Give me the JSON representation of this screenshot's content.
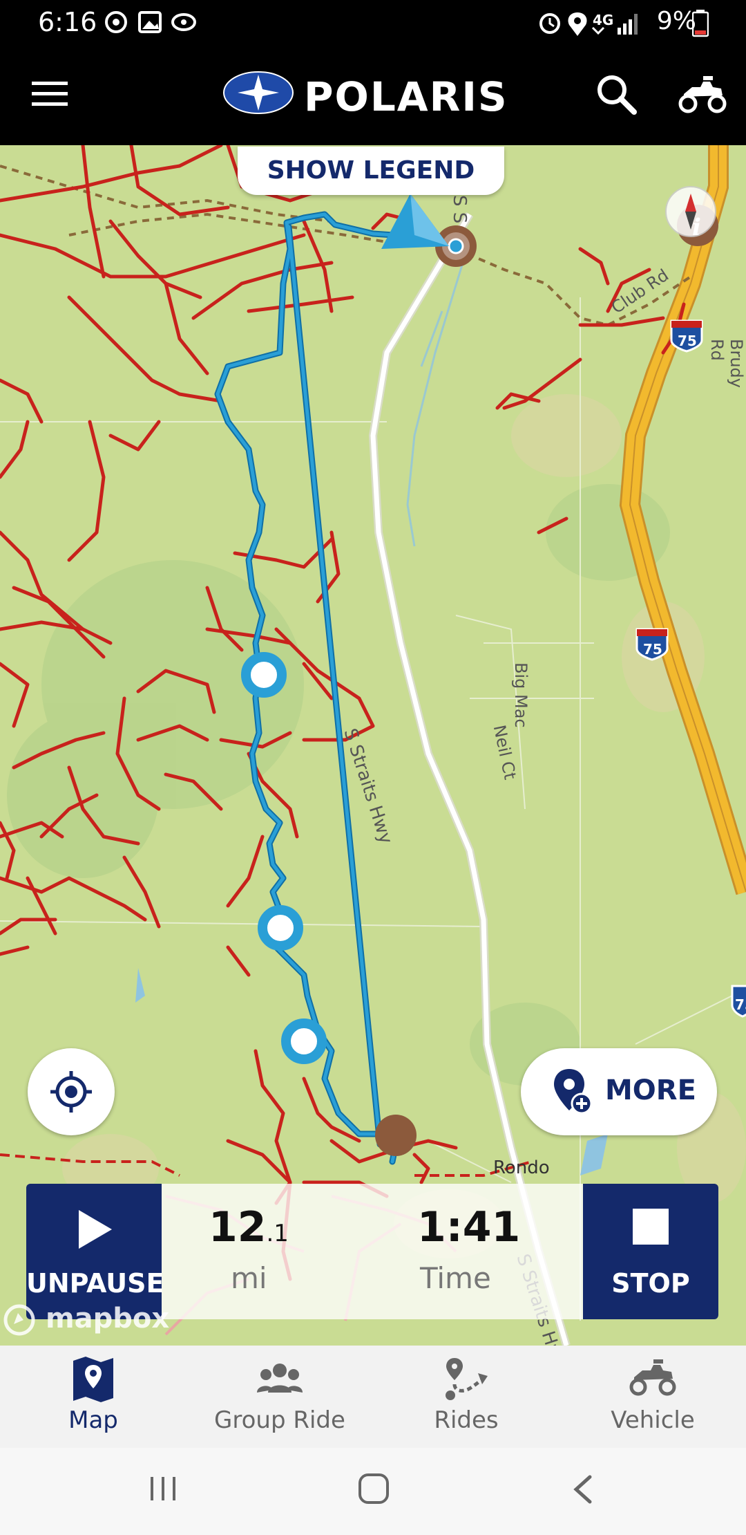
{
  "status_bar": {
    "time": "6:16",
    "network": "4G",
    "battery": "9%",
    "battery_color": "#e53935"
  },
  "header": {
    "brand": "POLARIS",
    "menu_icon": "hamburger-menu-icon",
    "search_icon": "search-icon",
    "vehicle_icon": "atv-icon",
    "brand_color": "#14296b"
  },
  "map": {
    "show_legend_label": "SHOW LEGEND",
    "labels": {
      "straits_hwy_1": "S Straits Hwy",
      "straits_hwy_2": "S Straits Hwy",
      "straits_top": "S S",
      "club_rd": "Club Rd",
      "brudy_rd": "Brudy Rd",
      "big_mac": "Big Mac",
      "neil_ct": "Neil Ct",
      "rondo": "Rondo",
      "i75_top": "75",
      "i75_mid": "75",
      "i75_right": "75"
    },
    "attribution": "mapbox",
    "more_label": "MORE",
    "colors": {
      "land": "#c9dc93",
      "trail": "#c8221c",
      "route": "#2a9fd6",
      "highway": "#f2b92e"
    }
  },
  "ride_panel": {
    "unpause_label": "UNPAUSE",
    "distance_whole": "12",
    "distance_decimal": ".1",
    "distance_unit": "mi",
    "time_value": "1:41",
    "time_label": "Time",
    "stop_label": "STOP"
  },
  "bottom_nav": {
    "items": [
      {
        "label": "Map",
        "icon": "map-icon",
        "active": true
      },
      {
        "label": "Group Ride",
        "icon": "group-icon",
        "active": false
      },
      {
        "label": "Rides",
        "icon": "route-icon",
        "active": false
      },
      {
        "label": "Vehicle",
        "icon": "atv-icon",
        "active": false
      }
    ]
  },
  "system_nav": {
    "recent_icon": "recent-apps-icon",
    "home_icon": "home-icon",
    "back_icon": "back-icon"
  }
}
